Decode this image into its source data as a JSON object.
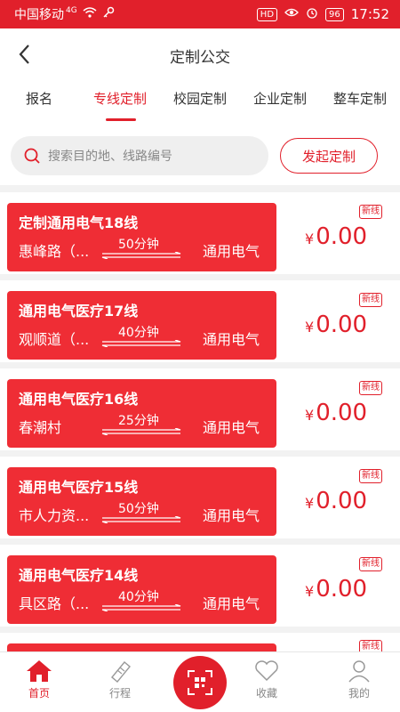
{
  "status_bar": {
    "carrier": "中国移动",
    "network": "4G",
    "battery": "96",
    "time": "17:52",
    "hd_label": "HD"
  },
  "header": {
    "title": "定制公交"
  },
  "tabs": [
    {
      "label": "报名",
      "active": false
    },
    {
      "label": "专线定制",
      "active": true
    },
    {
      "label": "校园定制",
      "active": false
    },
    {
      "label": "企业定制",
      "active": false
    },
    {
      "label": "整车定制",
      "active": false
    }
  ],
  "search": {
    "placeholder": "搜索目的地、线路编号",
    "launch_label": "发起定制"
  },
  "routes": [
    {
      "name": "定制通用电气18线",
      "from": "惠峰路（...",
      "duration": "50分钟",
      "to": "通用电气",
      "currency": "¥",
      "price": "0.00",
      "badge": "新线"
    },
    {
      "name": "通用电气医疗17线",
      "from": "观顺道（...",
      "duration": "40分钟",
      "to": "通用电气",
      "currency": "¥",
      "price": "0.00",
      "badge": "新线"
    },
    {
      "name": "通用电气医疗16线",
      "from": "春潮村",
      "duration": "25分钟",
      "to": "通用电气",
      "currency": "¥",
      "price": "0.00",
      "badge": "新线"
    },
    {
      "name": "通用电气医疗15线",
      "from": "市人力资...",
      "duration": "50分钟",
      "to": "通用电气",
      "currency": "¥",
      "price": "0.00",
      "badge": "新线"
    },
    {
      "name": "通用电气医疗14线",
      "from": "具区路（...",
      "duration": "40分钟",
      "to": "通用电气",
      "currency": "¥",
      "price": "0.00",
      "badge": "新线"
    }
  ],
  "partial_badge": "新线",
  "bottom_nav": [
    {
      "label": "首页",
      "icon": "home-icon",
      "active": true
    },
    {
      "label": "行程",
      "icon": "ticket-icon",
      "active": false
    },
    {
      "label": "",
      "icon": "scan-icon",
      "active": false
    },
    {
      "label": "收藏",
      "icon": "heart-icon",
      "active": false
    },
    {
      "label": "我的",
      "icon": "user-icon",
      "active": false
    }
  ],
  "colors": {
    "accent": "#e1202b",
    "card": "#ef2d35",
    "background": "#f2f2f2"
  }
}
